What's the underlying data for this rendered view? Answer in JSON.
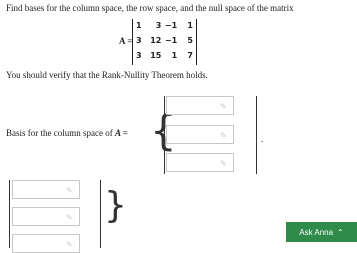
{
  "question": "Find bases for the column space, the row space, and the null space of the matrix",
  "matrix": {
    "label": "A =",
    "rows": [
      [
        "1",
        "3",
        "−1",
        "1"
      ],
      [
        "3",
        "12",
        "−1",
        "5"
      ],
      [
        "3",
        "15",
        "1",
        "7"
      ]
    ]
  },
  "verify_text": "You should verify that the Rank-Nullity Theorem holds.",
  "column_space_label": "Basis for the column space of",
  "column_space_var": "A =",
  "column_space_punct": ".",
  "icons": {
    "answer_field": "pencil-icon",
    "chat": "chevron-up-icon"
  },
  "ask_button": {
    "label": "Ask Anna"
  },
  "colors": {
    "ask_button_bg": "#2e8b4a"
  }
}
